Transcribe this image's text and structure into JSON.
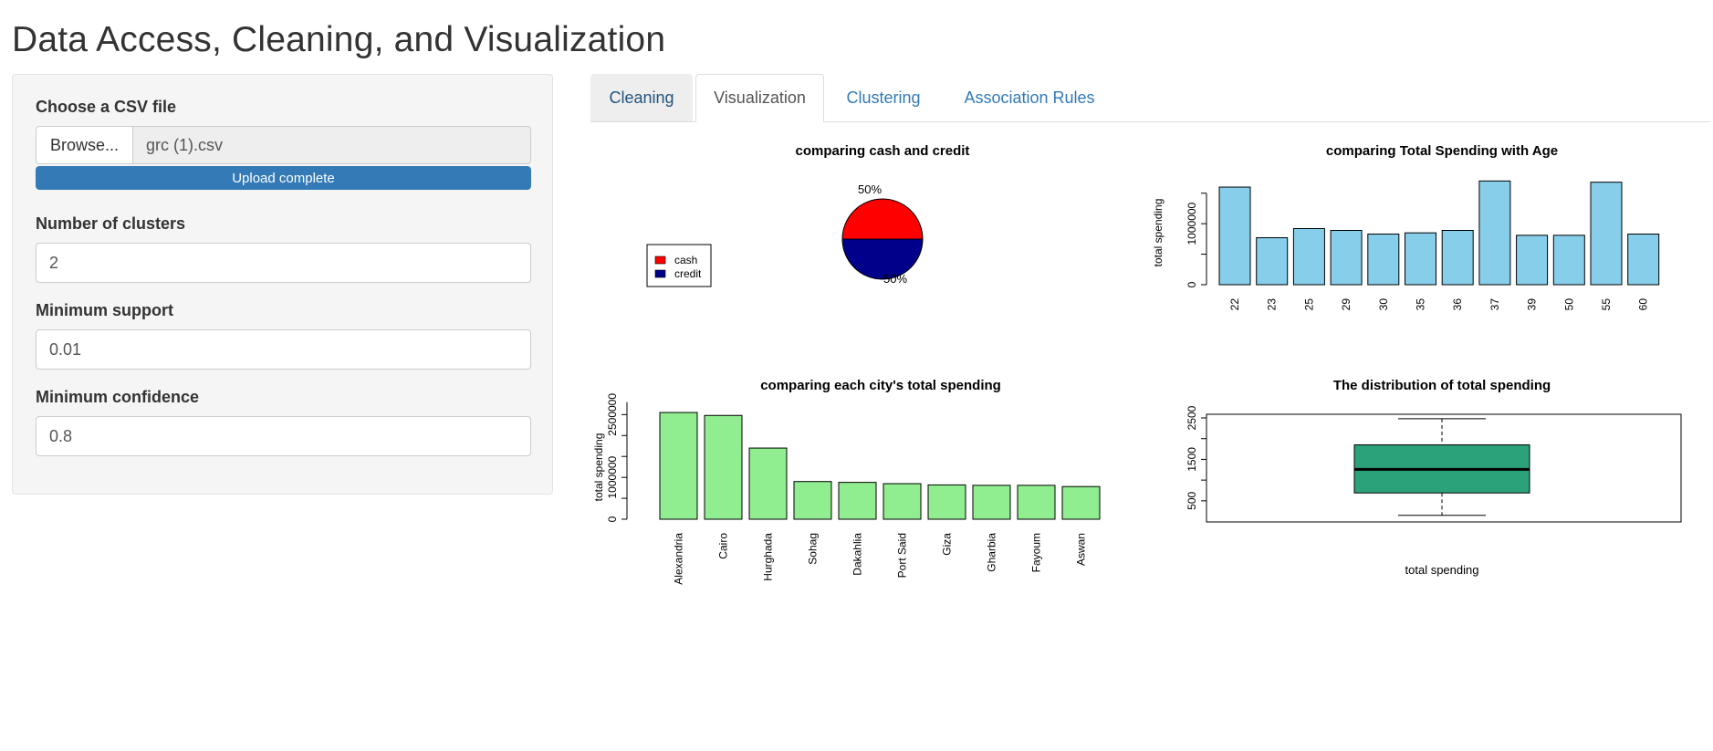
{
  "page": {
    "title": "Data Access, Cleaning, and Visualization"
  },
  "sidebar": {
    "file_label": "Choose a CSV file",
    "browse_label": "Browse...",
    "file_name": "grc (1).csv",
    "upload_status": "Upload complete",
    "upload_progress": 1.0,
    "clusters_label": "Number of clusters",
    "clusters_value": "2",
    "support_label": "Minimum support",
    "support_value": "0.01",
    "confidence_label": "Minimum confidence",
    "confidence_value": "0.8"
  },
  "tabs": [
    "Cleaning",
    "Visualization",
    "Clustering",
    "Association Rules"
  ],
  "active_tab": "Visualization",
  "colors": {
    "pie_cash": "#ff0000",
    "pie_credit": "#00008b",
    "age_bars": "#87ceeb",
    "city_bars": "#90ee90",
    "box_fill": "#2ca27a",
    "progress": "#337ab7",
    "link": "#337ab7"
  },
  "chart_data": [
    {
      "type": "pie",
      "title": "comparing cash and credit",
      "labels": [
        "cash",
        "credit"
      ],
      "values": [
        50,
        50
      ],
      "slice_labels": [
        "50%",
        "50%"
      ],
      "legend": "left"
    },
    {
      "type": "bar",
      "title": "comparing Total Spending with Age",
      "ylabel": "total spending",
      "categories": [
        "22",
        "23",
        "25",
        "29",
        "30",
        "35",
        "36",
        "37",
        "39",
        "50",
        "55",
        "60"
      ],
      "values": [
        1600000,
        770000,
        920000,
        890000,
        830000,
        850000,
        890000,
        1700000,
        810000,
        810000,
        1680000,
        830000
      ],
      "yticks": [
        "0",
        "1000000"
      ],
      "ylim": [
        0,
        1750000
      ]
    },
    {
      "type": "bar",
      "title": "comparing each city's total spending",
      "ylabel": "total spending",
      "categories": [
        "Alexandria",
        "Cairo",
        "Hurghada",
        "Sohag",
        "Dakahlia",
        "Port Said",
        "Giza",
        "Gharbia",
        "Fayoum",
        "Aswan"
      ],
      "values": [
        2550000,
        2480000,
        1700000,
        900000,
        880000,
        850000,
        820000,
        810000,
        810000,
        780000
      ],
      "yticks": [
        "0",
        "1000000",
        "2500000"
      ],
      "ylim": [
        0,
        2900000
      ]
    },
    {
      "type": "box",
      "title": "The distribution of total spending",
      "xlabel": "total spending",
      "stats": {
        "min": 150,
        "q1": 690,
        "median": 1260,
        "q3": 1850,
        "max": 2480
      },
      "yticks": [
        "500",
        "1500",
        "2500"
      ],
      "ylim": [
        0,
        2600
      ]
    }
  ]
}
